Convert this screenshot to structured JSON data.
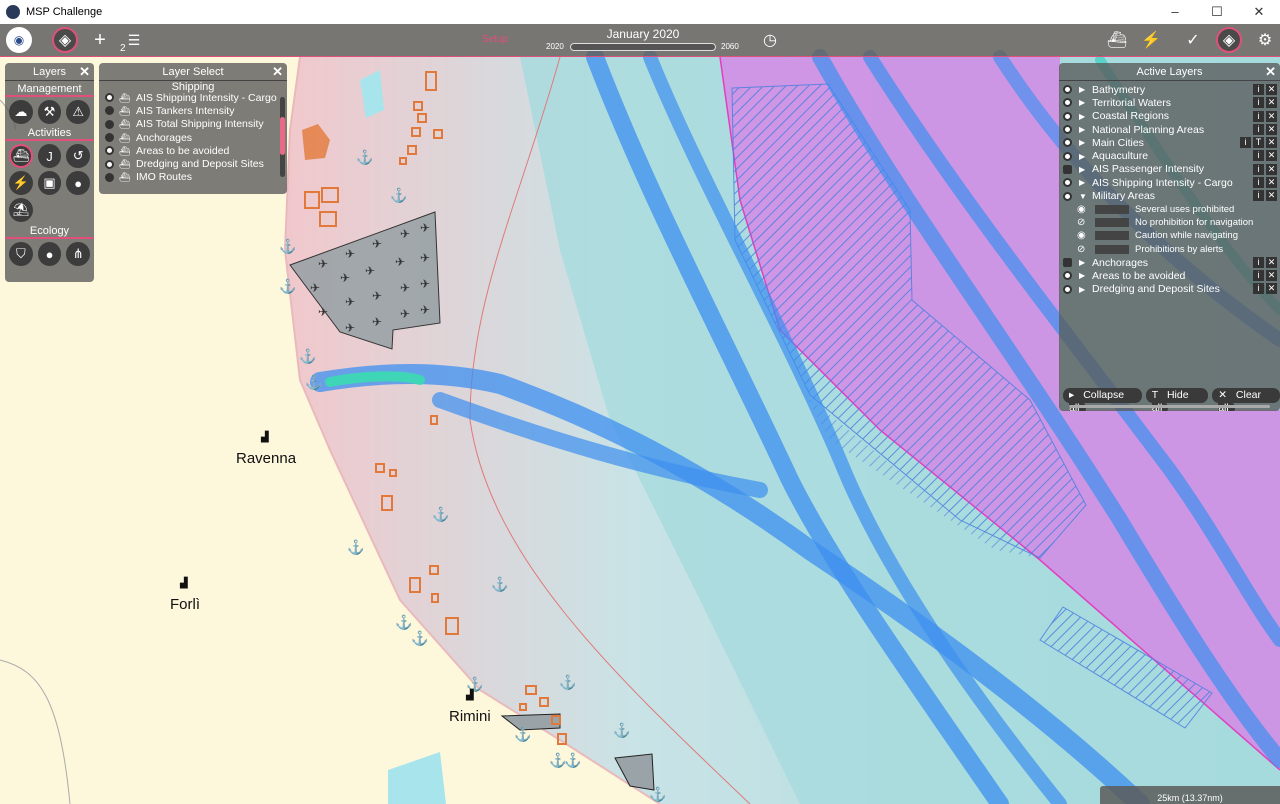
{
  "window": {
    "title": "MSP Challenge"
  },
  "toolbar": {
    "setup_label": "Setup",
    "date": "January 2020",
    "year_start": "2020",
    "year_end": "2060",
    "plans_badge": "2"
  },
  "layers_panel": {
    "title": "Layers",
    "sections": {
      "management": "Management",
      "activities": "Activities",
      "ecology": "Ecology"
    }
  },
  "layer_select": {
    "title": "Layer Select",
    "category": "Shipping",
    "items": [
      {
        "label": "AIS Shipping Intensity - Cargo",
        "checked": true
      },
      {
        "label": "AIS Tankers Intensity",
        "checked": false
      },
      {
        "label": "AIS Total Shipping Intensity",
        "checked": false
      },
      {
        "label": "Anchorages",
        "checked": false
      },
      {
        "label": "Areas to be avoided",
        "checked": true
      },
      {
        "label": "Dredging and Deposit Sites",
        "checked": true
      },
      {
        "label": "IMO Routes",
        "checked": false
      }
    ]
  },
  "active_layers": {
    "title": "Active Layers",
    "layers": [
      {
        "label": "Bathymetry",
        "on": true,
        "text_tool": false
      },
      {
        "label": "Territorial Waters",
        "on": true,
        "text_tool": false
      },
      {
        "label": "Coastal Regions",
        "on": true,
        "text_tool": false
      },
      {
        "label": "National Planning Areas",
        "on": true,
        "text_tool": false
      },
      {
        "label": "Main Cities",
        "on": true,
        "text_tool": true
      },
      {
        "label": "Aquaculture",
        "on": true,
        "text_tool": false
      },
      {
        "label": "AIS Passenger Intensity",
        "on": false,
        "text_tool": false
      },
      {
        "label": "AIS Shipping Intensity - Cargo",
        "on": true,
        "text_tool": false
      },
      {
        "label": "Military Areas",
        "on": true,
        "text_tool": false,
        "expanded": true
      }
    ],
    "military_sublayers": [
      {
        "label": "Several uses prohibited",
        "visible": true
      },
      {
        "label": "No prohibition for navigation",
        "visible": false
      },
      {
        "label": "Caution while navigating",
        "visible": true
      },
      {
        "label": "Prohibitions by alerts",
        "visible": false
      }
    ],
    "layers_after": [
      {
        "label": "Anchorages",
        "on": false
      },
      {
        "label": "Areas to be avoided",
        "on": true
      },
      {
        "label": "Dredging and Deposit Sites",
        "on": true
      }
    ],
    "buttons": {
      "collapse_all": "Collapse all",
      "hide_all": "Hide all",
      "clear_all": "Clear all"
    }
  },
  "map": {
    "cities": [
      {
        "name": "Ravenna"
      },
      {
        "name": "Forlì"
      },
      {
        "name": "Rimini"
      }
    ],
    "scale": "25km (13.37nm)",
    "colors": {
      "land": "#fdf7dc",
      "sea": "#a9dde0",
      "coast_pink": "#efc3c6",
      "military": "#d98be8",
      "shipping": "#4fa8ef",
      "aquaculture": "#e2793a"
    }
  }
}
